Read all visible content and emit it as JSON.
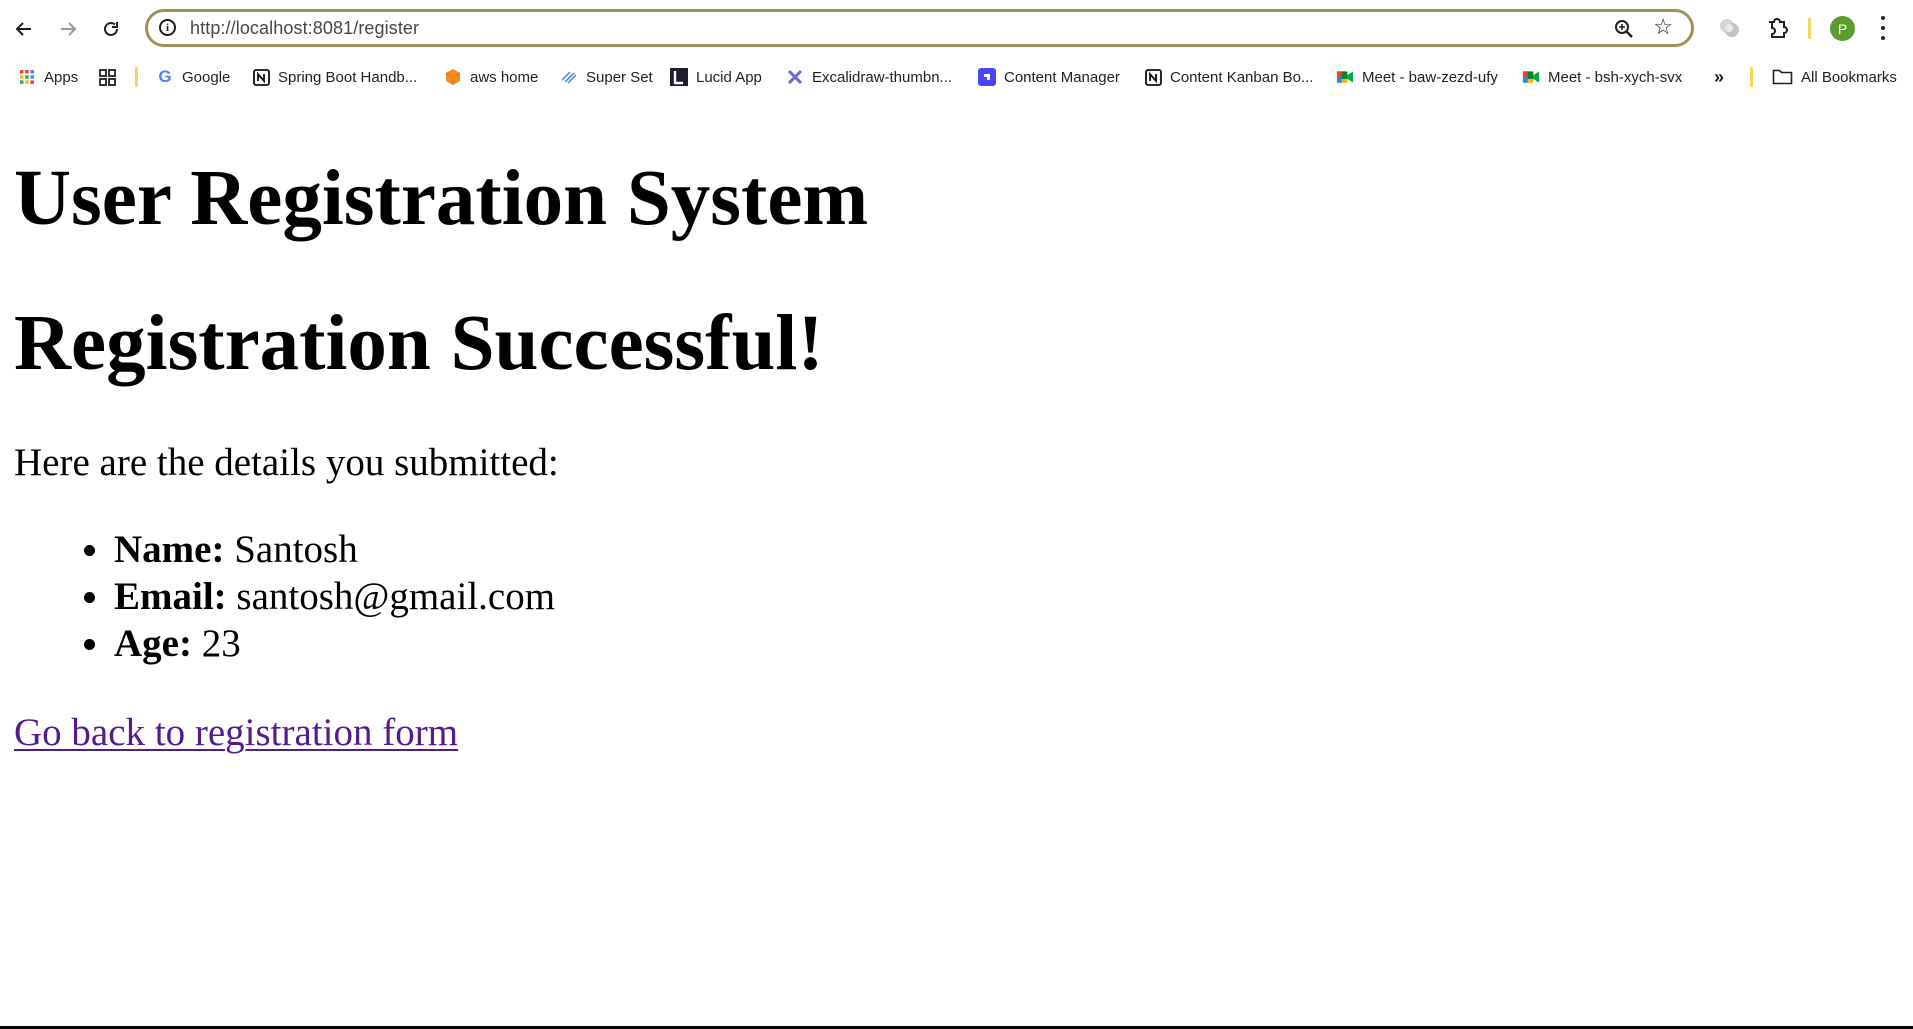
{
  "browser": {
    "url": "http://localhost:8081/register",
    "profile_initial": "P",
    "accent_colors": {
      "urlbar_border": "#9c9257",
      "avatar": "#5b9c2f",
      "separator": "#f6d55c",
      "visited_link": "#551a8b"
    },
    "toolbar_icons": [
      "back-arrow-icon",
      "forward-arrow-icon",
      "reload-icon",
      "site-info-icon",
      "zoom-icon",
      "bookmark-star-icon",
      "extension-blob-icon",
      "extensions-puzzle-icon",
      "profile-avatar",
      "kebab-menu-icon"
    ],
    "bookmarks": [
      {
        "label": "Apps",
        "icon": "apps-grid-icon"
      },
      {
        "label": "",
        "icon": "tab-groups-icon"
      },
      {
        "label": "Google",
        "icon": "google-icon"
      },
      {
        "label": "Spring Boot Handb...",
        "icon": "notion-icon"
      },
      {
        "label": "aws home",
        "icon": "aws-cube-icon"
      },
      {
        "label": "Super Set",
        "icon": "superset-icon"
      },
      {
        "label": "Lucid App",
        "icon": "lucid-icon"
      },
      {
        "label": "Excalidraw-thumbn...",
        "icon": "excalidraw-icon"
      },
      {
        "label": "Content Manager",
        "icon": "content-manager-icon"
      },
      {
        "label": "Content Kanban Bo...",
        "icon": "notion-icon"
      },
      {
        "label": "Meet - baw-zezd-ufy",
        "icon": "google-meet-icon"
      },
      {
        "label": "Meet - bsh-xych-svx",
        "icon": "google-meet-icon"
      }
    ],
    "overflow_label": "»",
    "all_bookmarks_label": "All Bookmarks"
  },
  "page": {
    "title": "User Registration System",
    "success_heading": "Registration Successful!",
    "intro": "Here are the details you submitted:",
    "details": [
      {
        "label": "Name:",
        "value": "Santosh"
      },
      {
        "label": "Email:",
        "value": "santosh@gmail.com"
      },
      {
        "label": "Age:",
        "value": "23"
      }
    ],
    "back_link": "Go back to registration form"
  }
}
